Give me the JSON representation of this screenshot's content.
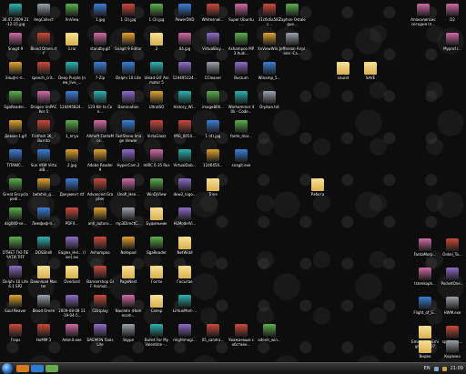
{
  "desktop": {
    "col0": [
      "30.07.2009 21-12-15.jpg",
      "Snagit 9",
      "Эльф-с-п...",
      "SgaReader...",
      "Демон-1.gif",
      "TITANIC...",
      "Great Encyclopedi...",
      "dsg040-se...",
      "OTHET ГЮ ПЕЧАТИ.TIFF",
      "Delphi 10 Lite 6.1 SP2",
      "Soul Reaver",
      "Fraps"
    ],
    "col1": [
      "ImgCollect",
      "Blood Omen.rtf",
      "speech_crit...",
      "Dragon UnPACKer 5",
      "Flatfoot 36_ - Burrito",
      "Sun VKM VirtualB...",
      "betehin_g...",
      "Лимфиф-п...",
      "DOSShell",
      "Download Master",
      "Blood Omen",
      "HoMM 3"
    ],
    "col2": [
      "XnView",
      "3.rar",
      "Deep Purple (new_live_...",
      "124495824...",
      "1_ягуа",
      "2.jpg",
      "Документ.rtf",
      "PDF4...",
      "Eagles_Hel... (live).avi",
      "Overlord",
      "2009-08-08 11-19-04-5...",
      "Adonit.exe"
    ],
    "col3": [
      "1.jpg",
      "standby.gif",
      "7-Zip",
      "123 Kill to Con...",
      "Allmoft FantaMor...",
      "Adobe Reader 9",
      "Advanced Grapher",
      "anti_autoru...",
      "Ashampoo",
      "Bannershop GIF Animat...",
      "CDisplay",
      "DAEMON Tools Lite"
    ],
    "col4": [
      "1 (2).jpg",
      "Snagit 9 Editor",
      "Delphi 10 Lite",
      "Damination",
      "FastStone Image Viewer",
      "HyperCam 2",
      "Unofi_Hee...",
      "mp3DirectC...",
      "Notepad",
      "PageNest",
      "Naviletn (Homecom...",
      "Skype"
    ],
    "col5": [
      "1 (3).jpg",
      "2",
      "Ulead GIF Animator 5",
      "UltraISO",
      "VistaGlazz",
      "mIRC 6.35 Rus",
      "WinDjView",
      "Будильник",
      "SgaReader",
      "Гости",
      "Сапер",
      "Bullet For My Valentine -..."
    ],
    "col6": [
      "PowerDVD",
      "04.jpg",
      "124495124...",
      "History_Wi...",
      "IMG_0054...",
      "VirtualDub...",
      "dow2_logo...",
      "HLModelVi...",
      "NetWidd",
      "Госыгае",
      "LimuxMint-...",
      "mightmagi..."
    ],
    "col7": [
      "Whitesnak...",
      "VirtualBoy...",
      "CCleaner",
      "image806...",
      "1 (4).jpg",
      "1246456...",
      "Trine",
      "",
      "",
      "",
      "",
      "05_sandra..."
    ],
    "col8": [
      "Super Ubuntu ...",
      "Ashampoo MP3 Audi...",
      "Burzum",
      "Warhammer 40k - Code...",
      "fante_mor...",
      "snagit.exe",
      "",
      "",
      "",
      "",
      "",
      "Уважаемые собствен..."
    ],
    "col9": [
      "31c6s6a582c...",
      "XnViewWin...",
      "Winamp_5...",
      "Orphan.txt",
      "",
      "",
      "",
      "",
      "",
      "",
      "",
      "adonit_win..."
    ],
    "col10": [
      "Zaphire Ostalogue...",
      "Jefferson Airplane -Ca...",
      "",
      "",
      "",
      "",
      "",
      "",
      "",
      "",
      "",
      ""
    ],
    "right_top": {
      "a": "Апокалипсис сегодня (п...",
      "b": "D2",
      "c": "Myprof.r...",
      "sound": "sound",
      "save": "SAVE"
    },
    "mid_folder": "Работа",
    "right_col": [
      "FantaMorp...",
      "tstenkoph...",
      "Flight_of_S...",
      "Emigrate - Emigrate 2007",
      "Видео"
    ],
    "right_col2": [
      "Onkel_To...",
      "PocketOne...",
      "HWM.exe",
      "spiderma...",
      "Корзина"
    ]
  },
  "taskbar": {
    "lang": "EN",
    "clock": "21:09"
  },
  "colors": {
    "desktop": "#0d0d0d",
    "taskbar": "#2a2a2a",
    "label": "#ffffff"
  }
}
